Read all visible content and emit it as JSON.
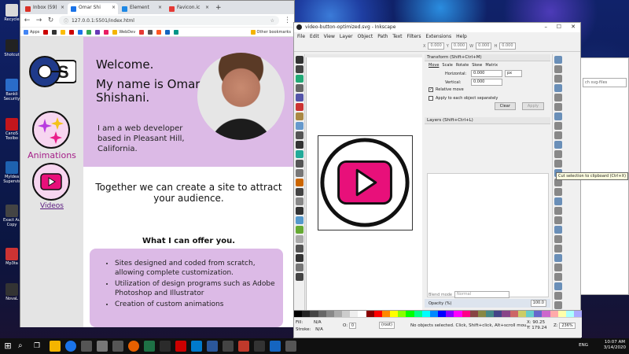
{
  "desktop": {
    "icons": [
      {
        "label": "Recycle",
        "color": "#d9d9d9"
      },
      {
        "label": "Shotcut",
        "color": "#222"
      },
      {
        "label": "Bankli Security",
        "color": "#2a6cc9"
      },
      {
        "label": "CanoS Toolbo",
        "color": "#c4161c"
      },
      {
        "label": "MyIdea Supervis",
        "color": "#1e62b0"
      },
      {
        "label": "Exact Au Copy",
        "color": "#444"
      },
      {
        "label": "Mp3ta",
        "color": "#c33"
      },
      {
        "label": "NovaL",
        "color": "#333"
      }
    ]
  },
  "chrome": {
    "tabs": [
      {
        "label": "Inbox (59)",
        "fav_color": "#d93025",
        "active": false
      },
      {
        "label": "Omar Shi",
        "fav_color": "#1a73e8",
        "active": true
      },
      {
        "label": "Element",
        "fav_color": "#1e88e5",
        "active": false
      },
      {
        "label": "Favicon.ic",
        "fav_color": "#e53935",
        "active": false
      },
      {
        "label": "+",
        "fav_color": "",
        "active": false
      }
    ],
    "url": "127.0.0.1:5501/index.html",
    "bookmarks": [
      "Apps",
      "",
      "",
      "",
      "",
      "",
      "",
      "",
      "",
      "WebDev",
      "",
      "",
      "",
      "",
      "",
      "Other bookmarks"
    ]
  },
  "page": {
    "logo_text": "OS",
    "nav": {
      "animations": "Animations",
      "videos": "Videos"
    },
    "welcome": "Welcome.",
    "name": "My name is Omar Shishani.",
    "intro": "I am a web developer based in Pleasant Hill, California.",
    "tagline": "Together we can create a site to attract your audience.",
    "offer_title": "What I can offer you.",
    "offers": [
      "Sites designed and coded from scratch, allowing complete customization.",
      "Utilization of design programs such as Adobe Photoshop and Illustrator",
      "Creation of custom animations"
    ],
    "accent": "#a51e88",
    "panel_color": "#dcbae6"
  },
  "inkscape": {
    "title": "video-button-optimized.svg - Inkscape",
    "menu": [
      "File",
      "Edit",
      "View",
      "Layer",
      "Object",
      "Path",
      "Text",
      "Filters",
      "Extensions",
      "Help"
    ],
    "coords": {
      "x": "0.000",
      "y": "0.000",
      "w": "0.000",
      "h": "0.000"
    },
    "transform": {
      "header": "Transform (Shift+Ctrl+M)",
      "tabs": [
        "Move",
        "Scale",
        "Rotate",
        "Skew",
        "Matrix"
      ],
      "horizontal_label": "Horizontal:",
      "horizontal": "0.000",
      "vertical_label": "Vertical:",
      "vertical": "0.000",
      "unit": "px",
      "relative": "Relative move",
      "separately": "Apply to each object separately",
      "clear": "Clear",
      "apply": "Apply"
    },
    "layers": {
      "header": "Layers (Shift+Ctrl+L)",
      "blend_label": "Blend mode",
      "blend": "Normal",
      "opacity_label": "Opacity (%)",
      "opacity": "100.0"
    },
    "tooltip": "Cut selection to clipboard (Ctrl+X)",
    "status": {
      "fill_label": "Fill:",
      "fill": "N/A",
      "stroke_label": "Stroke:",
      "stroke": "N/A",
      "o_label": "O:",
      "o": "0",
      "layer": "(root)",
      "message": "No objects selected. Click, Shift+click, Alt+scroll mou...",
      "x": "90.25",
      "y": "179.24",
      "zoom": "236%",
      "z_label": "Z:",
      "x_label": "X:",
      "y_label": "Y:"
    },
    "button_color": "#e8107a"
  },
  "explorer": {
    "search": "ch svg-files"
  },
  "taskbar": {
    "time": "10:07 AM",
    "date": "3/14/2020",
    "lang": "ENG"
  }
}
